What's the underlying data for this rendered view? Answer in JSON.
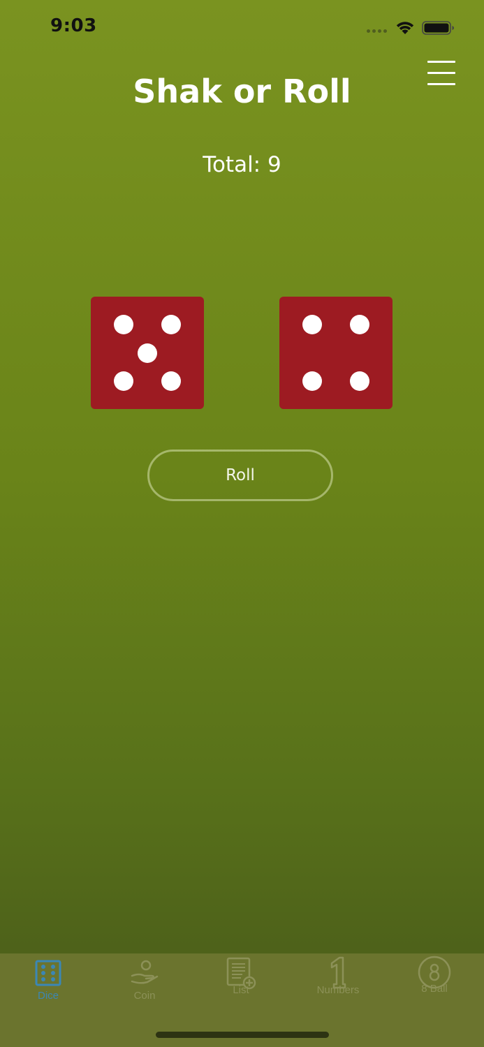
{
  "status_bar": {
    "time": "9:03"
  },
  "header": {
    "title": "Shak or Roll",
    "menu_icon": "hamburger-menu-icon"
  },
  "total": {
    "text": "Total: 9",
    "value": 9
  },
  "dice": [
    {
      "value": 5,
      "color": "#9d1b22",
      "pip_color": "#ffffff"
    },
    {
      "value": 4,
      "color": "#9d1b22",
      "pip_color": "#ffffff"
    }
  ],
  "roll_button": {
    "label": "Roll"
  },
  "tab_bar": {
    "active_color": "#3b87b5",
    "inactive_color": "#8c9158",
    "tabs": [
      {
        "label": "Dice",
        "icon": "dice-icon",
        "active": true
      },
      {
        "label": "Coin",
        "icon": "coin-hand-icon",
        "active": false
      },
      {
        "label": "List",
        "icon": "list-add-icon",
        "active": false
      },
      {
        "label": "Numbers",
        "icon": "number-one-icon",
        "active": false
      },
      {
        "label": "8 Ball",
        "icon": "eight-ball-icon",
        "active": false
      }
    ]
  },
  "colors": {
    "background_top": "#7a9320",
    "background_bottom": "#48591a",
    "die_red": "#9d1b22",
    "tab_bar": "#6b742e"
  }
}
